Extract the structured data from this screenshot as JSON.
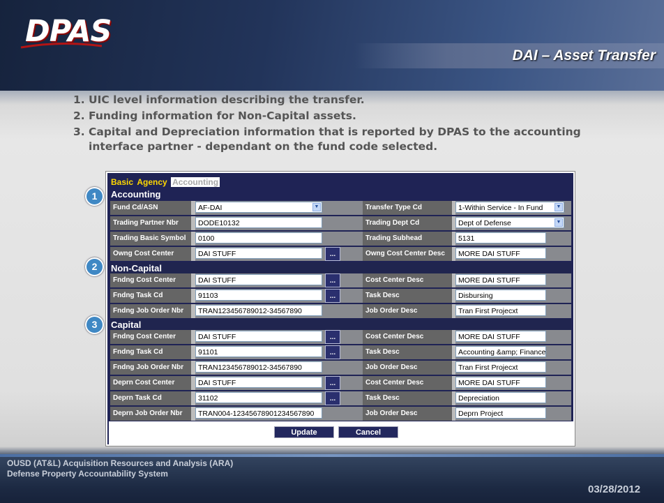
{
  "logo": {
    "text": "DPAS"
  },
  "slide_title": "DAI – Asset Transfer",
  "bullets": [
    {
      "num": "1.",
      "text": "UIC level information describing the transfer."
    },
    {
      "num": "2.",
      "text": "Funding information for Non-Capital assets."
    },
    {
      "num": "3.",
      "text": "Capital and Depreciation information that is reported by DPAS to the accounting interface partner - dependant on the fund code selected."
    }
  ],
  "tabs": {
    "basic": "Basic",
    "agency": "Agency",
    "accounting": "Accounting"
  },
  "badges": [
    "1",
    "2",
    "3"
  ],
  "sections": {
    "accounting": "Accounting",
    "noncapital": "Non-Capital",
    "capital": "Capital"
  },
  "lookup_label": "...",
  "accounting_rows": [
    {
      "left_label": "Fund Cd/ASN",
      "left_value": "AF-DAI",
      "right_label": "Transfer Type Cd",
      "right_value": "1-Within Service - In Fund"
    },
    {
      "left_label": "Trading Partner Nbr",
      "left_value": "DODE10132",
      "right_label": "Trading Dept Cd",
      "right_value": "Dept of Defense"
    },
    {
      "left_label": "Trading Basic Symbol",
      "left_value": "0100",
      "right_label": "Trading Subhead",
      "right_value": "5131"
    },
    {
      "left_label": "Owng Cost Center",
      "left_value": "DAI STUFF",
      "right_label": "Owng Cost Center Desc",
      "right_value": "MORE DAI STUFF"
    }
  ],
  "noncapital_rows": [
    {
      "left_label": "Fndng Cost Center",
      "left_value": "DAI STUFF",
      "right_label": "Cost Center Desc",
      "right_value": "MORE DAI STUFF"
    },
    {
      "left_label": "Fndng Task Cd",
      "left_value": "91103",
      "right_label": "Task Desc",
      "right_value": "Disbursing"
    },
    {
      "left_label": "Fndng Job Order Nbr",
      "left_value": "TRAN123456789012-34567890",
      "right_label": "Job Order Desc",
      "right_value": "Tran First Projecxt"
    }
  ],
  "capital_rows": [
    {
      "left_label": "Fndng Cost Center",
      "left_value": "DAI STUFF",
      "right_label": "Cost Center Desc",
      "right_value": "MORE DAI STUFF"
    },
    {
      "left_label": "Fndng Task Cd",
      "left_value": "91101",
      "right_label": "Task Desc",
      "right_value": "Accounting &amp; Finance"
    },
    {
      "left_label": "Fndng Job Order Nbr",
      "left_value": "TRAN123456789012-34567890",
      "right_label": "Job Order Desc",
      "right_value": "Tran First Projecxt"
    },
    {
      "left_label": "Deprn Cost Center",
      "left_value": "DAI STUFF",
      "right_label": "Cost Center Desc",
      "right_value": "MORE DAI STUFF"
    },
    {
      "left_label": "Deprn Task Cd",
      "left_value": "31102",
      "right_label": "Task Desc",
      "right_value": "Depreciation"
    },
    {
      "left_label": "Deprn Job Order Nbr",
      "left_value": "TRAN004-12345678901234567890",
      "right_label": "Job Order Desc",
      "right_value": "Deprn Project"
    }
  ],
  "buttons": {
    "update": "Update",
    "cancel": "Cancel"
  },
  "footer": {
    "line1": "OUSD (AT&L) Acquisition Resources and Analysis (ARA)",
    "line2": "Defense Property Accountability System",
    "date": "03/28/2012"
  }
}
